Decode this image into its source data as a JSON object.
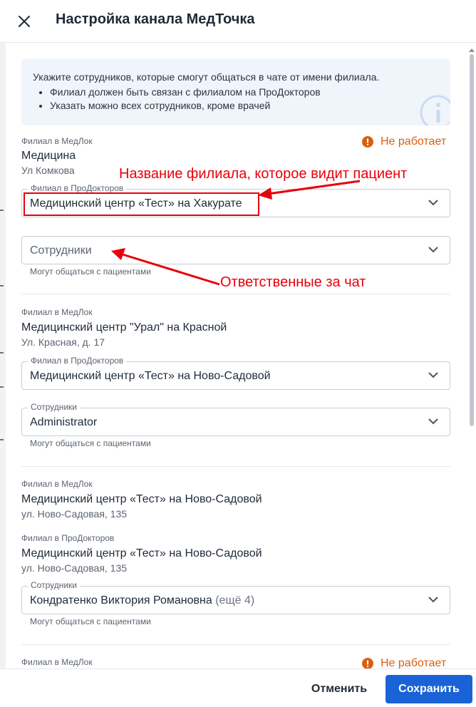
{
  "header": {
    "title": "Настройка канала МедТочка",
    "close_icon": "close-icon"
  },
  "info": {
    "text": "Укажите сотрудников, которые смогут общаться в чате от имени филиала.",
    "bullets": [
      "Филиал должен быть связан с филиалом на ПроДокторов",
      "Указать можно всех сотрудников, кроме врачей"
    ],
    "icon": "info-icon"
  },
  "branches": [
    {
      "medlock_label": "Филиал в МедЛок",
      "status": "Не работает",
      "name": "Медицина",
      "address": "Ул Комкова",
      "prodoctorov_label": "Филиал в ПроДокторов",
      "prodoctorov_value": "Медицинский центр «Тест» на Хакурате",
      "employees_placeholder": "Сотрудники",
      "employees_hint": "Могут общаться с пациентами"
    },
    {
      "medlock_label": "Филиал в МедЛок",
      "name": "Медицинский центр \"Урал\" на Красной",
      "address": "Ул. Красная, д. 17",
      "prodoctorov_label": "Филиал в ПроДокторов",
      "prodoctorov_value": "Медицинский центр «Тест» на Ново-Садовой",
      "employees_label": "Сотрудники",
      "employees_value": "Administrator",
      "employees_hint": "Могут общаться с пациентами"
    },
    {
      "medlock_label": "Филиал в МедЛок",
      "name": "Медицинский центр «Тест» на Ново-Садовой",
      "address": "ул. Ново-Садовая, 135",
      "prodoctorov_label": "Филиал в ПроДокторов",
      "prodoctorov_name": "Медицинский центр «Тест» на Ново-Садовой",
      "prodoctorov_address": "ул. Ново-Садовая, 135",
      "employees_label": "Сотрудники",
      "employees_value": "Кондратенко Виктория Романовна",
      "employees_more": "(ещё 4)",
      "employees_hint": "Могут общаться с пациентами"
    },
    {
      "medlock_label": "Филиал в МедЛок",
      "status": "Не работает"
    }
  ],
  "annotations": {
    "branch_name": "Название филиала, которое видит пациент",
    "responsible": "Ответственные за чат"
  },
  "footer": {
    "cancel_label": "Отменить",
    "save_label": "Сохранить"
  },
  "colors": {
    "accent": "#1a63d6",
    "warning": "#d96010",
    "annotation": "#e8000b",
    "info_bg": "#f0f5fb"
  }
}
